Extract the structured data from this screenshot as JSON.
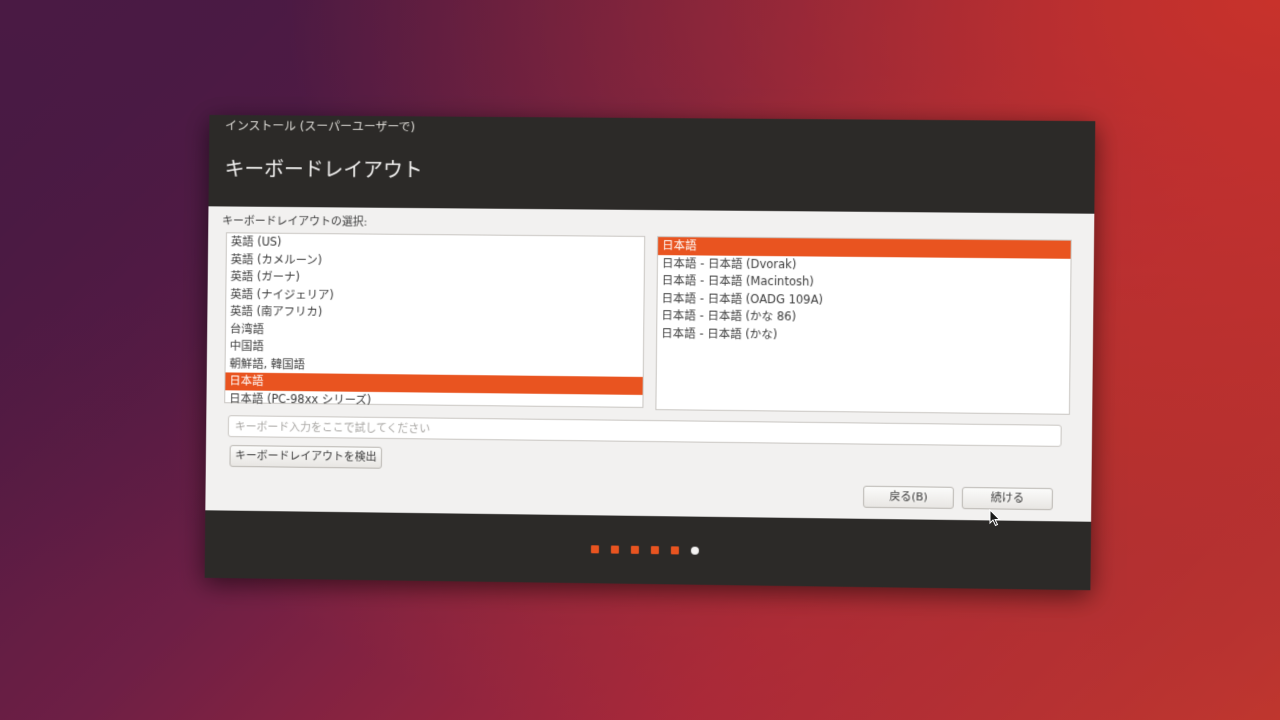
{
  "window": {
    "title": "インストール (スーパーユーザーで)",
    "page_title": "キーボードレイアウト"
  },
  "layout_section": {
    "label": "キーボードレイアウトの選択:"
  },
  "layouts": [
    {
      "label": "英語 (US)",
      "selected": false
    },
    {
      "label": "英語 (カメルーン)",
      "selected": false
    },
    {
      "label": "英語 (ガーナ)",
      "selected": false
    },
    {
      "label": "英語 (ナイジェリア)",
      "selected": false
    },
    {
      "label": "英語 (南アフリカ)",
      "selected": false
    },
    {
      "label": "台湾語",
      "selected": false
    },
    {
      "label": "中国語",
      "selected": false
    },
    {
      "label": "朝鮮語, 韓国語",
      "selected": false
    },
    {
      "label": "日本語",
      "selected": true
    },
    {
      "label": "日本語 (PC-98xx シリーズ)",
      "selected": false
    }
  ],
  "variants": [
    {
      "label": "日本語",
      "selected": true
    },
    {
      "label": "日本語 - 日本語 (Dvorak)",
      "selected": false
    },
    {
      "label": "日本語 - 日本語 (Macintosh)",
      "selected": false
    },
    {
      "label": "日本語 - 日本語 (OADG 109A)",
      "selected": false
    },
    {
      "label": "日本語 - 日本語 (かな 86)",
      "selected": false
    },
    {
      "label": "日本語 - 日本語 (かな)",
      "selected": false
    }
  ],
  "test_input": {
    "placeholder": "キーボード入力をここで試してください",
    "value": ""
  },
  "buttons": {
    "detect": "キーボードレイアウトを検出",
    "back": "戻る(B)",
    "continue": "続ける"
  },
  "progress": {
    "total_steps": 6,
    "current_step": 6
  },
  "colors": {
    "accent": "#e95420",
    "window_dark": "#2c2a28",
    "content_bg": "#f2f1f0"
  }
}
